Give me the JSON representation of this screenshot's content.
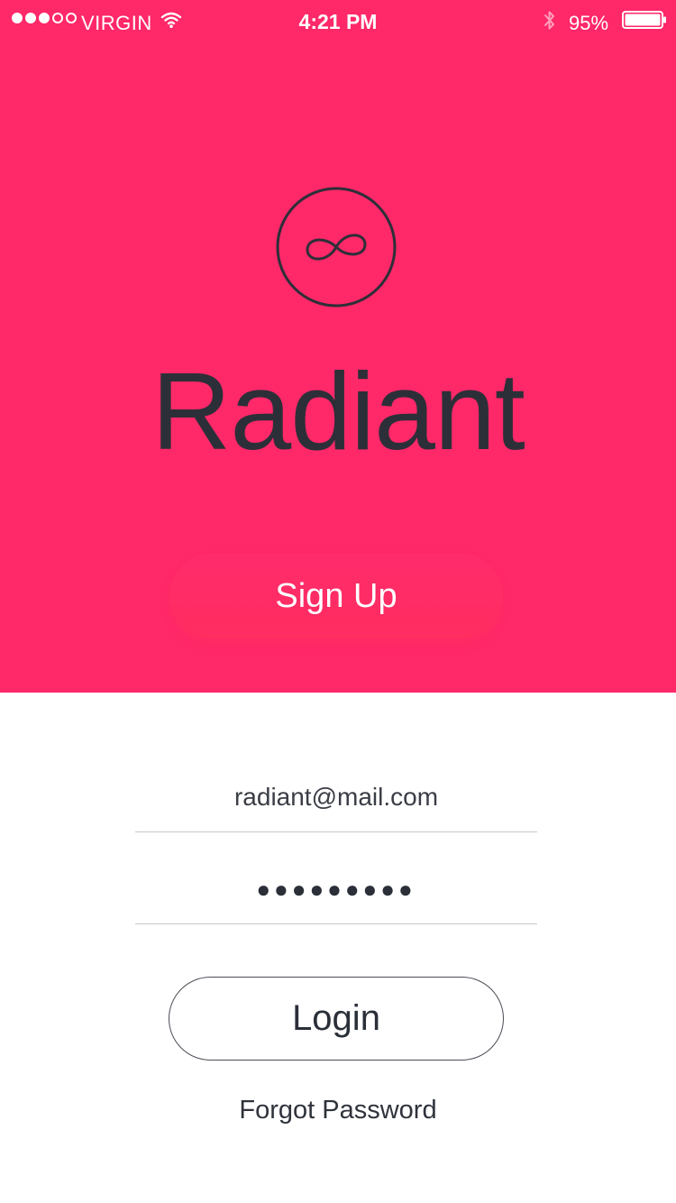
{
  "status_bar": {
    "signal_strength": 3,
    "signal_max": 5,
    "carrier": "VIRGIN",
    "time": "4:21 PM",
    "battery_percent": "95%",
    "battery_level": 0.95,
    "icons": [
      "wifi-icon",
      "bluetooth-icon",
      "battery-icon"
    ]
  },
  "brand": {
    "logo_icon": "infinity-loop-circle-icon",
    "title": "Radiant",
    "accent_color": "#ff2869",
    "text_color": "#2d2f38"
  },
  "hero": {
    "signup_label": "Sign Up"
  },
  "login_form": {
    "email_value": "radiant@mail.com",
    "password_masked": "●●●●●●●●●",
    "login_label": "Login",
    "forgot_label": "Forgot Password"
  }
}
